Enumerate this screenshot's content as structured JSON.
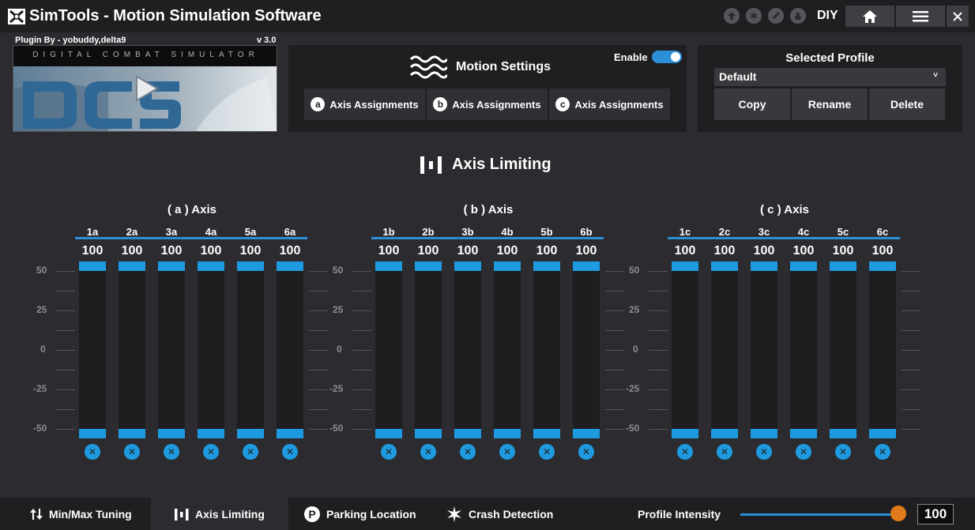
{
  "app": {
    "title": "SimTools - Motion Simulation Software",
    "diy_label": "DIY"
  },
  "plugin": {
    "by": "Plugin By - yobuddy,delta9",
    "version": "v 3.0",
    "banner_text": "DIGITAL COMBAT SIMULATOR",
    "logo_text": "DCS"
  },
  "motion": {
    "title": "Motion Settings",
    "enable_label": "Enable",
    "enabled": true,
    "axis_buttons": [
      {
        "letter": "a",
        "label": "Axis Assignments"
      },
      {
        "letter": "b",
        "label": "Axis Assignments"
      },
      {
        "letter": "c",
        "label": "Axis Assignments"
      }
    ]
  },
  "profile": {
    "title": "Selected Profile",
    "selected": "Default",
    "buttons": {
      "copy": "Copy",
      "rename": "Rename",
      "delete": "Delete"
    }
  },
  "page_title": "Axis Limiting",
  "axis_groups": [
    {
      "title": "( a ) Axis",
      "columns": [
        {
          "label": "1a",
          "value": "100"
        },
        {
          "label": "2a",
          "value": "100"
        },
        {
          "label": "3a",
          "value": "100"
        },
        {
          "label": "4a",
          "value": "100"
        },
        {
          "label": "5a",
          "value": "100"
        },
        {
          "label": "6a",
          "value": "100"
        }
      ]
    },
    {
      "title": "( b ) Axis",
      "columns": [
        {
          "label": "1b",
          "value": "100"
        },
        {
          "label": "2b",
          "value": "100"
        },
        {
          "label": "3b",
          "value": "100"
        },
        {
          "label": "4b",
          "value": "100"
        },
        {
          "label": "5b",
          "value": "100"
        },
        {
          "label": "6b",
          "value": "100"
        }
      ]
    },
    {
      "title": "( c ) Axis",
      "columns": [
        {
          "label": "1c",
          "value": "100"
        },
        {
          "label": "2c",
          "value": "100"
        },
        {
          "label": "3c",
          "value": "100"
        },
        {
          "label": "4c",
          "value": "100"
        },
        {
          "label": "5c",
          "value": "100"
        },
        {
          "label": "6c",
          "value": "100"
        }
      ]
    }
  ],
  "scale_ticks": [
    "50",
    "25",
    "0",
    "-25",
    "-50"
  ],
  "bottom_tabs": [
    {
      "label": "Min/Max Tuning",
      "icon": "arrows-updown-icon",
      "active": false
    },
    {
      "label": "Axis Limiting",
      "icon": "axis-limit-icon",
      "active": true
    },
    {
      "label": "Parking Location",
      "icon": "parking-icon",
      "active": false
    },
    {
      "label": "Crash Detection",
      "icon": "crash-icon",
      "active": false
    }
  ],
  "intensity": {
    "label": "Profile Intensity",
    "value": "100",
    "slider_fraction": 1.0
  },
  "colors": {
    "accent": "#1e9ae0",
    "knob": "#e07a1a",
    "background": "#2b2b30",
    "panel": "#1f1f22"
  }
}
